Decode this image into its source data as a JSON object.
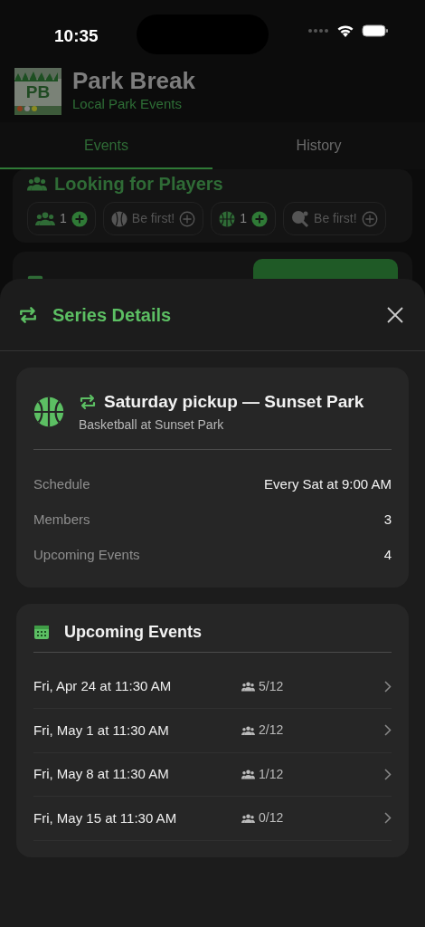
{
  "status_bar": {
    "time": "10:35"
  },
  "app": {
    "logo_text": "PB",
    "title": "Park Break",
    "subtitle": "Local Park Events"
  },
  "tabs": [
    {
      "label": "Events",
      "selected": true
    },
    {
      "label": "History",
      "selected": false
    }
  ],
  "looking_for_players": {
    "title": "Looking for Players",
    "chips": [
      {
        "kind": "group",
        "label": "1",
        "has_players": true
      },
      {
        "kind": "baseball",
        "label": "Be first!",
        "has_players": false
      },
      {
        "kind": "basketball",
        "label": "1",
        "has_players": true
      },
      {
        "kind": "pingpong",
        "label": "Be first!",
        "has_players": false
      }
    ]
  },
  "sheet": {
    "title": "Series Details",
    "series": {
      "name": "Saturday pickup — Sunset Park",
      "subtitle": "Basketball at Sunset Park",
      "details": [
        {
          "label": "Schedule",
          "value": "Every Sat at 9:00 AM"
        },
        {
          "label": "Members",
          "value": "3"
        },
        {
          "label": "Upcoming Events",
          "value": "4"
        }
      ]
    },
    "upcoming": {
      "title": "Upcoming Events",
      "events": [
        {
          "date": "Fri, Apr 24 at 11:30 AM",
          "players": "5/12"
        },
        {
          "date": "Fri, May 1 at 11:30 AM",
          "players": "2/12"
        },
        {
          "date": "Fri, May 8 at 11:30 AM",
          "players": "1/12"
        },
        {
          "date": "Fri, May 15 at 11:30 AM",
          "players": "0/12"
        }
      ]
    }
  }
}
